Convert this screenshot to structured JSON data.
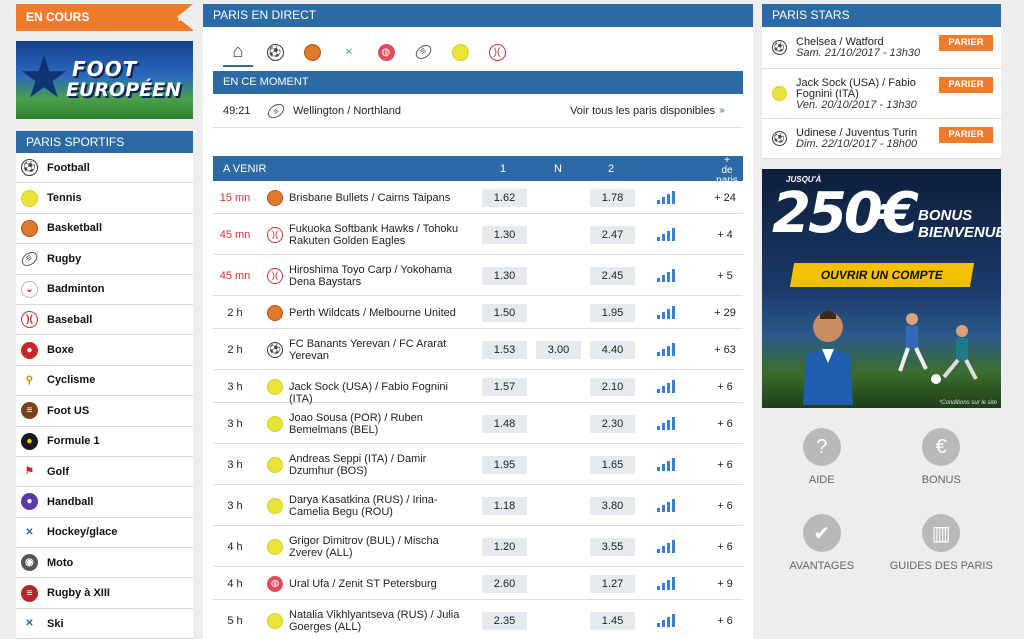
{
  "left": {
    "en_cours": "EN COURS",
    "banner_line1": "FOOT",
    "banner_line2": "EUROPÉEN",
    "sports_title": "PARIS SPORTIFS",
    "sports": [
      {
        "label": "Football",
        "icon": "soccer-ball-icon"
      },
      {
        "label": "Tennis",
        "icon": "tennis-ball-icon"
      },
      {
        "label": "Basketball",
        "icon": "basketball-icon"
      },
      {
        "label": "Rugby",
        "icon": "rugby-ball-icon"
      },
      {
        "label": "Badminton",
        "icon": "shuttlecock-icon"
      },
      {
        "label": "Baseball",
        "icon": "baseball-icon"
      },
      {
        "label": "Boxe",
        "icon": "boxing-glove-icon"
      },
      {
        "label": "Cyclisme",
        "icon": "bicycle-icon"
      },
      {
        "label": "Foot US",
        "icon": "american-football-icon"
      },
      {
        "label": "Formule 1",
        "icon": "f1-icon"
      },
      {
        "label": "Golf",
        "icon": "golf-flag-icon"
      },
      {
        "label": "Handball",
        "icon": "handball-icon"
      },
      {
        "label": "Hockey/glace",
        "icon": "hockey-stick-icon"
      },
      {
        "label": "Moto",
        "icon": "motorbike-icon"
      },
      {
        "label": "Rugby à XIII",
        "icon": "rugby-xiii-icon"
      },
      {
        "label": "Ski",
        "icon": "ski-icon"
      }
    ]
  },
  "middle": {
    "title": "PARIS EN DIRECT",
    "tabs": [
      "home-icon",
      "soccer-ball-icon",
      "basketball-icon",
      "badminton-icon",
      "volleyball-icon",
      "rugby-ball-icon",
      "tennis-ball-icon",
      "baseball-icon"
    ],
    "en_ce_moment": "EN CE MOMENT",
    "live": {
      "time": "49:21",
      "teams": "Wellington / Northland",
      "all_bets": "Voir tous les paris disponibles"
    },
    "avenir": {
      "title": "A VENIR",
      "col1": "1",
      "colN": "N",
      "col2": "2",
      "plus_symbol": "+",
      "plus_label": "de paris"
    },
    "matches": [
      {
        "time": "15 mn",
        "red": true,
        "icon": "basketball-icon",
        "teams": "Brisbane Bullets / Cairns Taipans",
        "o1": "1.62",
        "oN": "",
        "o2": "1.78",
        "more": "+ 24"
      },
      {
        "time": "45 mn",
        "red": true,
        "icon": "baseball-icon",
        "teams": "Fukuoka Softbank Hawks / Tohoku Rakuten Golden Eagles",
        "o1": "1.30",
        "oN": "",
        "o2": "2.47",
        "more": "+ 4"
      },
      {
        "time": "45 mn",
        "red": true,
        "icon": "baseball-icon",
        "teams": "Hiroshima Toyo Carp / Yokohama Dena Baystars",
        "o1": "1.30",
        "oN": "",
        "o2": "2.45",
        "more": "+ 5"
      },
      {
        "time": "2 h",
        "red": false,
        "icon": "basketball-icon",
        "teams": "Perth Wildcats / Melbourne United",
        "o1": "1.50",
        "oN": "",
        "o2": "1.95",
        "more": "+ 29"
      },
      {
        "time": "2 h",
        "red": false,
        "icon": "soccer-ball-icon",
        "teams": "FC Banants Yerevan / FC Ararat Yerevan",
        "o1": "1.53",
        "oN": "3.00",
        "o2": "4.40",
        "more": "+ 63"
      },
      {
        "time": "3 h",
        "red": false,
        "icon": "tennis-ball-icon",
        "teams": "Jack Sock (USA) / Fabio Fognini (ITA)",
        "o1": "1.57",
        "oN": "",
        "o2": "2.10",
        "more": "+ 6"
      },
      {
        "time": "3 h",
        "red": false,
        "icon": "tennis-ball-icon",
        "teams": "Joao Sousa (POR) / Ruben Bemelmans (BEL)",
        "o1": "1.48",
        "oN": "",
        "o2": "2.30",
        "more": "+ 6"
      },
      {
        "time": "3 h",
        "red": false,
        "icon": "tennis-ball-icon",
        "teams": "Andreas Seppi (ITA) / Damir Dzumhur (BOS)",
        "o1": "1.95",
        "oN": "",
        "o2": "1.65",
        "more": "+ 6"
      },
      {
        "time": "3 h",
        "red": false,
        "icon": "tennis-ball-icon",
        "teams": "Darya Kasatkina (RUS) / Irina-Camelia Begu (ROU)",
        "o1": "1.18",
        "oN": "",
        "o2": "3.80",
        "more": "+ 6"
      },
      {
        "time": "4 h",
        "red": false,
        "icon": "tennis-ball-icon",
        "teams": "Grigor Dimitrov (BUL) / Mischa Zverev (ALL)",
        "o1": "1.20",
        "oN": "",
        "o2": "3.55",
        "more": "+ 6"
      },
      {
        "time": "4 h",
        "red": false,
        "icon": "volleyball-icon",
        "teams": "Ural Ufa / Zenit ST Petersburg",
        "o1": "2.60",
        "oN": "",
        "o2": "1.27",
        "more": "+ 9"
      },
      {
        "time": "5 h",
        "red": false,
        "icon": "tennis-ball-icon",
        "teams": "Natalia Vikhlyantseva (RUS) / Julia Goerges (ALL)",
        "o1": "2.35",
        "oN": "",
        "o2": "1.45",
        "more": "+ 6"
      }
    ]
  },
  "right": {
    "stars_title": "PARIS STARS",
    "stars": [
      {
        "icon": "soccer-ball-icon",
        "teams": "Chelsea / Watford",
        "date": "Sam. 21/10/2017 - 13h30",
        "btn": "PARIER"
      },
      {
        "icon": "tennis-ball-icon",
        "teams": "Jack Sock (USA) / Fabio Fognini (ITA)",
        "date": "Ven. 20/10/2017 - 13h30",
        "btn": "PARIER"
      },
      {
        "icon": "soccer-ball-icon",
        "teams": "Udinese / Juventus Turin",
        "date": "Dim. 22/10/2017 - 18h00",
        "btn": "PARIER"
      }
    ],
    "promo": {
      "jusqua": "JUSQU'À",
      "amount": "250€",
      "bonus1": "BONUS",
      "bonus2": "BIENVENUE",
      "cta": "OUVRIR UN COMPTE",
      "conditions": "*Conditions sur le site"
    },
    "quick": [
      {
        "label": "AIDE",
        "icon": "help-icon"
      },
      {
        "label": "BONUS",
        "icon": "euro-icon"
      },
      {
        "label": "AVANTAGES",
        "icon": "check-icon"
      },
      {
        "label": "GUIDES DES PARIS",
        "icon": "book-icon"
      }
    ]
  },
  "colors": {
    "orange": "#f07c2b",
    "blue": "#2c6aa6",
    "red_time": "#d32f2f",
    "yellow_cta": "#f5c000"
  }
}
